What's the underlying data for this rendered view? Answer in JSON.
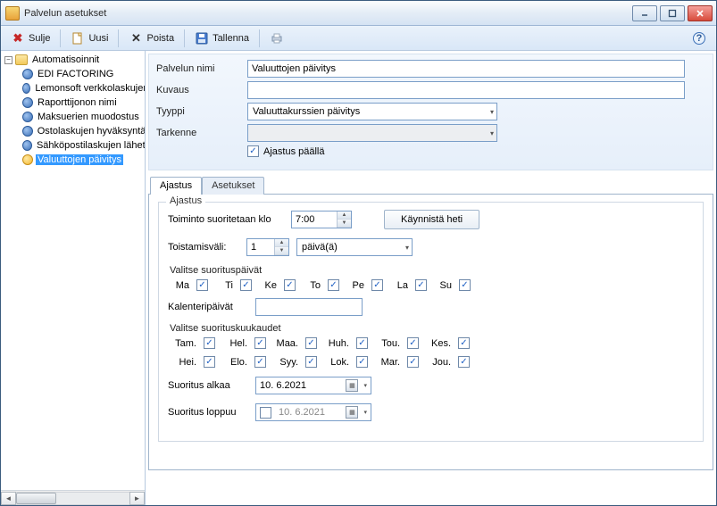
{
  "window": {
    "title": "Palvelun asetukset"
  },
  "toolbar": {
    "close": "Sulje",
    "new": "Uusi",
    "delete": "Poista",
    "save": "Tallenna"
  },
  "tree": {
    "root": "Automatisoinnit",
    "items": [
      "EDI FACTORING",
      "Lemonsoft verkkolaskujen lähetys",
      "Raporttijonon nimi",
      "Maksuerien muodostus",
      "Ostolaskujen hyväksyntä",
      "Sähköpostilaskujen lähetys",
      "Valuuttojen päivitys"
    ],
    "selectedIndex": 6
  },
  "form": {
    "labels": {
      "name": "Palvelun nimi",
      "desc": "Kuvaus",
      "type": "Tyyppi",
      "spec": "Tarkenne"
    },
    "name": "Valuuttojen päivitys",
    "desc": "",
    "type": "Valuuttakurssien päivitys",
    "spec": "",
    "scheduleOn": "Ajastus päällä"
  },
  "tabs": {
    "schedule": "Ajastus",
    "settings": "Asetukset"
  },
  "schedule": {
    "legend": "Ajastus",
    "runAtLabel": "Toiminto suoritetaan klo",
    "runAt": "7:00",
    "runNow": "Käynnistä heti",
    "repeatLabel": "Toistamisväli:",
    "repeatValue": "1",
    "repeatUnit": "päivä(ä)",
    "daysLabel": "Valitse suorituspäivät",
    "days": [
      "Ma",
      "Ti",
      "Ke",
      "To",
      "Pe",
      "La",
      "Su"
    ],
    "calDaysLabel": "Kalenteripäivät",
    "calDays": "",
    "monthsLabel": "Valitse suorituskuukaudet",
    "months": [
      "Tam.",
      "Hel.",
      "Maa.",
      "Huh.",
      "Tou.",
      "Kes.",
      "Hei.",
      "Elo.",
      "Syy.",
      "Lok.",
      "Mar.",
      "Jou."
    ],
    "startLabel": "Suoritus alkaa",
    "startDate": "10. 6.2021",
    "endLabel": "Suoritus loppuu",
    "endDate": "10. 6.2021"
  }
}
